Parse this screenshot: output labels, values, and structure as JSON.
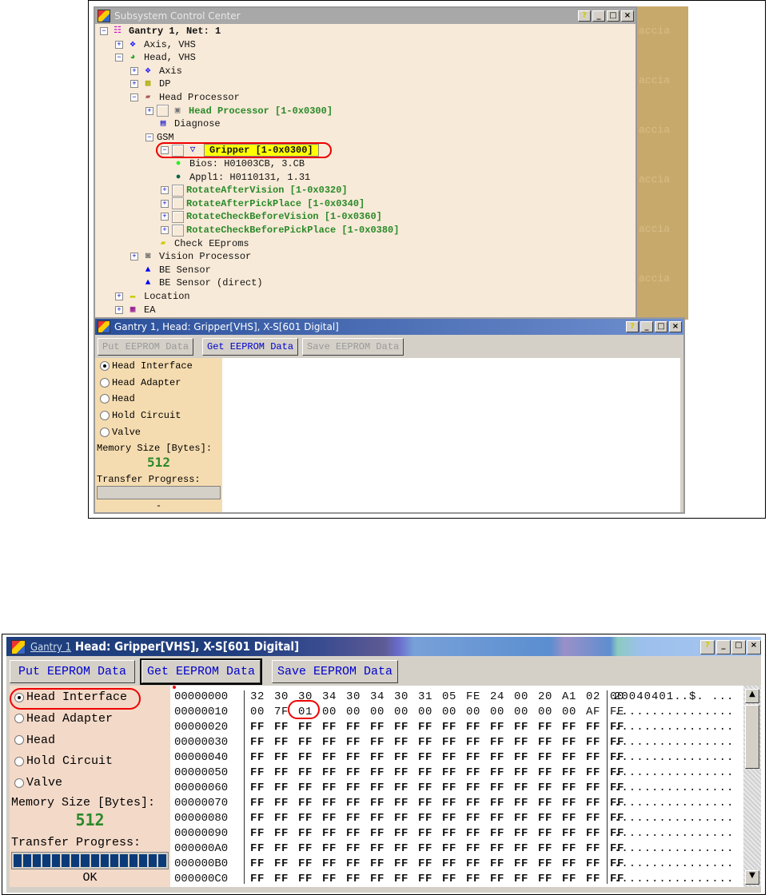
{
  "top_window": {
    "title": "Subsystem Control Center",
    "desktop_watermark": "accia",
    "tree": [
      {
        "label": "Gantry 1, Net: 1",
        "level": 0,
        "exp": "-",
        "icon": "tree-icon",
        "style": "bold"
      },
      {
        "label": "Axis, VHS",
        "level": 1,
        "exp": "+",
        "icon": "axis-icon"
      },
      {
        "label": "Head, VHS",
        "level": 1,
        "exp": "-",
        "icon": "head-icon"
      },
      {
        "label": "Axis",
        "level": 2,
        "exp": "+",
        "icon": "axis-icon"
      },
      {
        "label": "DP",
        "level": 2,
        "exp": "+",
        "icon": "dp-icon"
      },
      {
        "label": "Head Processor",
        "level": 2,
        "exp": "-",
        "icon": "chip-icon"
      },
      {
        "label": "Head Processor [1-0x0300]",
        "level": 3,
        "exp": "+",
        "check": true,
        "icon": "processor-icon",
        "style": "green"
      },
      {
        "label": "Diagnose",
        "level": 3,
        "exp": "",
        "icon": "diagnose-icon"
      },
      {
        "label": "GSM",
        "level": 3,
        "exp": "-",
        "icon": ""
      },
      {
        "label": "Gripper [1-0x0300]",
        "level": 4,
        "exp": "-",
        "check": true,
        "icon": "gripper-icon",
        "style": "hl"
      },
      {
        "label": "Bios: H01003CB, 3.CB",
        "level": 5,
        "exp": "",
        "icon": "green-dot-icon"
      },
      {
        "label": "Appl1: H0110131, 1.31",
        "level": 5,
        "exp": "",
        "icon": "dark-green-dot-icon"
      },
      {
        "label": "RotateAfterVision [1-0x0320]",
        "level": 4,
        "exp": "+",
        "check": true,
        "icon": "",
        "style": "green"
      },
      {
        "label": "RotateAfterPickPlace [1-0x0340]",
        "level": 4,
        "exp": "+",
        "check": true,
        "icon": "",
        "style": "green"
      },
      {
        "label": "RotateCheckBeforeVision [1-0x0360]",
        "level": 4,
        "exp": "+",
        "check": true,
        "icon": "",
        "style": "green"
      },
      {
        "label": "RotateCheckBeforePickPlace [1-0x0380]",
        "level": 4,
        "exp": "+",
        "check": true,
        "icon": "",
        "style": "green"
      },
      {
        "label": "Check EEproms",
        "level": 3,
        "exp": "",
        "icon": "eeprom-icon"
      },
      {
        "label": "Vision Processor",
        "level": 2,
        "exp": "+",
        "icon": "camera-icon"
      },
      {
        "label": "BE Sensor",
        "level": 2,
        "exp": "",
        "icon": "sensor-icon"
      },
      {
        "label": "BE Sensor (direct)",
        "level": 2,
        "exp": "",
        "icon": "sensor-icon"
      },
      {
        "label": "Location",
        "level": 1,
        "exp": "+",
        "icon": "location-icon"
      },
      {
        "label": "EA",
        "level": 1,
        "exp": "+",
        "icon": "ea-icon"
      }
    ]
  },
  "small_dialog": {
    "title": "Gantry 1, Head: Gripper[VHS], X-S[601 Digital]",
    "buttons": [
      "Put EEPROM Data",
      "Get EEPROM Data",
      "Save EEPROM Data"
    ],
    "radios": [
      "Head Interface",
      "Head Adapter",
      "Head",
      "Hold Circuit",
      "Valve"
    ],
    "selected": 0,
    "memory_label": "Memory Size [Bytes]:",
    "memory_value": "512",
    "progress_label": "Transfer Progress:",
    "progress": 0,
    "status": "-"
  },
  "large_dialog": {
    "title_link": "Gantry 1",
    "title": "Head: Gripper[VHS], X-S[601 Digital]",
    "buttons": [
      "Put EEPROM Data",
      "Get EEPROM Data",
      "Save EEPROM Data"
    ],
    "radios": [
      "Head Interface",
      "Head Adapter",
      "Head",
      "Hold Circuit",
      "Valve"
    ],
    "selected": 0,
    "memory_label": "Memory Size [Bytes]:",
    "memory_value": "512",
    "progress_label": "Transfer Progress:",
    "progress": 1.0,
    "status": "OK",
    "hex_rows": [
      {
        "offset": "00000000",
        "bytes": "32 30 30 34 30 34 30 31 05 FE 24 00 20 A1 02 00",
        "ascii": "20040401..$. ..."
      },
      {
        "offset": "00000010",
        "bytes": "00 7F 01 00 00 00 00 00 00 00 00 00 00 00 AF FE",
        "ascii": "................"
      },
      {
        "offset": "00000020",
        "bytes": "FF FF FF FF FF FF FF FF FF FF FF FF FF FF FF FF",
        "ascii": "................"
      },
      {
        "offset": "00000030",
        "bytes": "FF FF FF FF FF FF FF FF FF FF FF FF FF FF FF FF",
        "ascii": "................"
      },
      {
        "offset": "00000040",
        "bytes": "FF FF FF FF FF FF FF FF FF FF FF FF FF FF FF FF",
        "ascii": "................"
      },
      {
        "offset": "00000050",
        "bytes": "FF FF FF FF FF FF FF FF FF FF FF FF FF FF FF FF",
        "ascii": "................"
      },
      {
        "offset": "00000060",
        "bytes": "FF FF FF FF FF FF FF FF FF FF FF FF FF FF FF FF",
        "ascii": "................"
      },
      {
        "offset": "00000070",
        "bytes": "FF FF FF FF FF FF FF FF FF FF FF FF FF FF FF FF",
        "ascii": "................"
      },
      {
        "offset": "00000080",
        "bytes": "FF FF FF FF FF FF FF FF FF FF FF FF FF FF FF FF",
        "ascii": "................"
      },
      {
        "offset": "00000090",
        "bytes": "FF FF FF FF FF FF FF FF FF FF FF FF FF FF FF FF",
        "ascii": "................"
      },
      {
        "offset": "000000A0",
        "bytes": "FF FF FF FF FF FF FF FF FF FF FF FF FF FF FF FF",
        "ascii": "................"
      },
      {
        "offset": "000000B0",
        "bytes": "FF FF FF FF FF FF FF FF FF FF FF FF FF FF FF FF",
        "ascii": "................"
      },
      {
        "offset": "000000C0",
        "bytes": "FF FF FF FF FF FF FF FF FF FF FF FF FF FF FF FF",
        "ascii": "................"
      }
    ]
  }
}
